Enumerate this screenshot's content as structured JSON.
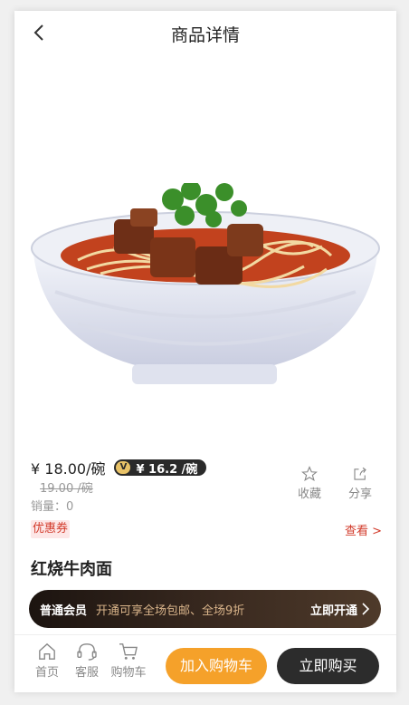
{
  "header": {
    "title": "商品详情"
  },
  "product": {
    "name": "红烧牛肉面",
    "price": "¥ 18.00/碗",
    "vip_badge": "V",
    "vip_price": "¥ 16.2 /碗",
    "original_price": "19.00 /碗",
    "sales": "销量：0",
    "coupon": "优惠券",
    "view_link": "查看 >"
  },
  "actions": {
    "favorite": "收藏",
    "share": "分享"
  },
  "member": {
    "level": "普通会员",
    "desc": "开通可享全场包邮、全场9折",
    "cta": "立即开通"
  },
  "bottom_nav": {
    "home": "首页",
    "service": "客服",
    "cart": "购物车",
    "add_to_cart": "加入购物车",
    "buy_now": "立即购买"
  },
  "colors": {
    "accent_red": "#d23a2a",
    "cart_orange": "#f5a12a",
    "buy_dark": "#2c2c2c",
    "gold": "#d9b48a"
  }
}
